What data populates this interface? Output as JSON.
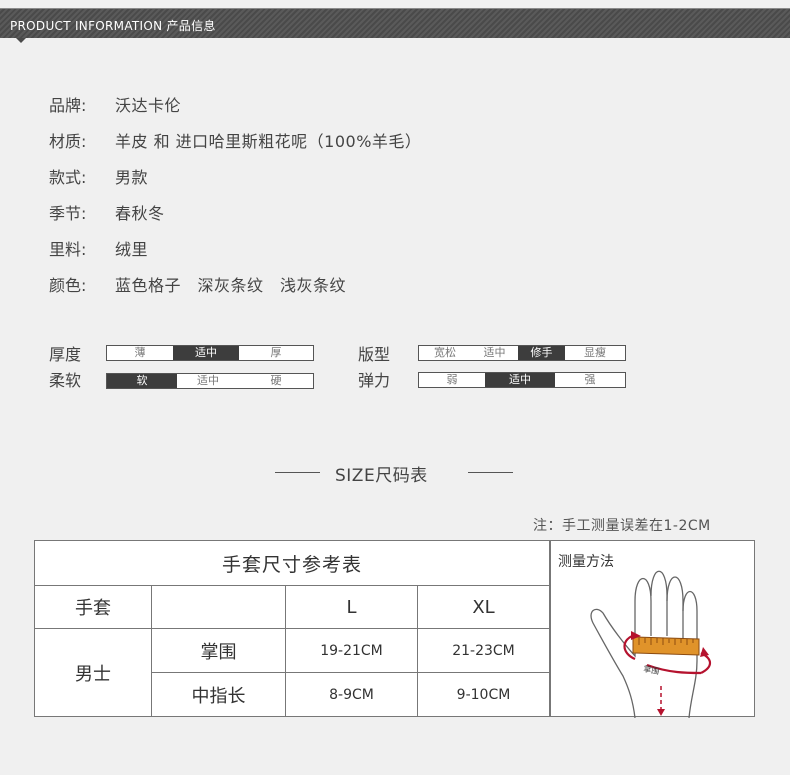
{
  "header": {
    "title": "PRODUCT INFORMATION  产品信息"
  },
  "info": [
    {
      "label": "品牌:",
      "value": "沃达卡伦"
    },
    {
      "label": "材质:",
      "value": "羊皮 和 进口哈里斯粗花呢（100%羊毛）"
    },
    {
      "label": "款式:",
      "value": "男款"
    },
    {
      "label": "季节:",
      "value": "春秋冬"
    },
    {
      "label": "里料:",
      "value": "绒里"
    },
    {
      "label": "颜色:",
      "value": "蓝色格子　深灰条纹　浅灰条纹"
    }
  ],
  "attributes": {
    "thickness": {
      "label": "厚度",
      "options": [
        "薄",
        "适中",
        "厚"
      ],
      "selected": "适中"
    },
    "fit": {
      "label": "版型",
      "options": [
        "宽松",
        "适中",
        "修手",
        "显瘦"
      ],
      "selected": "修手"
    },
    "softness": {
      "label": "柔软",
      "options": [
        "软",
        "适中",
        "硬"
      ],
      "selected": "软"
    },
    "elasticity": {
      "label": "弹力",
      "options": [
        "弱",
        "适中",
        "强"
      ],
      "selected": "适中"
    }
  },
  "size_section": {
    "title": "SIZE尺码表",
    "note": "注：手工测量误差在1-2CM"
  },
  "size_table": {
    "caption": "手套尺寸参考表",
    "header_label": "手套",
    "sizes": [
      "L",
      "XL"
    ],
    "group": "男士",
    "rows": [
      {
        "name": "掌围",
        "values": [
          "19-21CM",
          "21-23CM"
        ]
      },
      {
        "name": "中指长",
        "values": [
          "8-9CM",
          "9-10CM"
        ]
      }
    ]
  },
  "measure": {
    "label": "测量方法",
    "palm_label": "掌围"
  },
  "colors": {
    "header_bg": "#4a4a4a",
    "active_scale": "#3d3d3d",
    "tape": "#e0932a",
    "arrow": "#b5122e"
  }
}
